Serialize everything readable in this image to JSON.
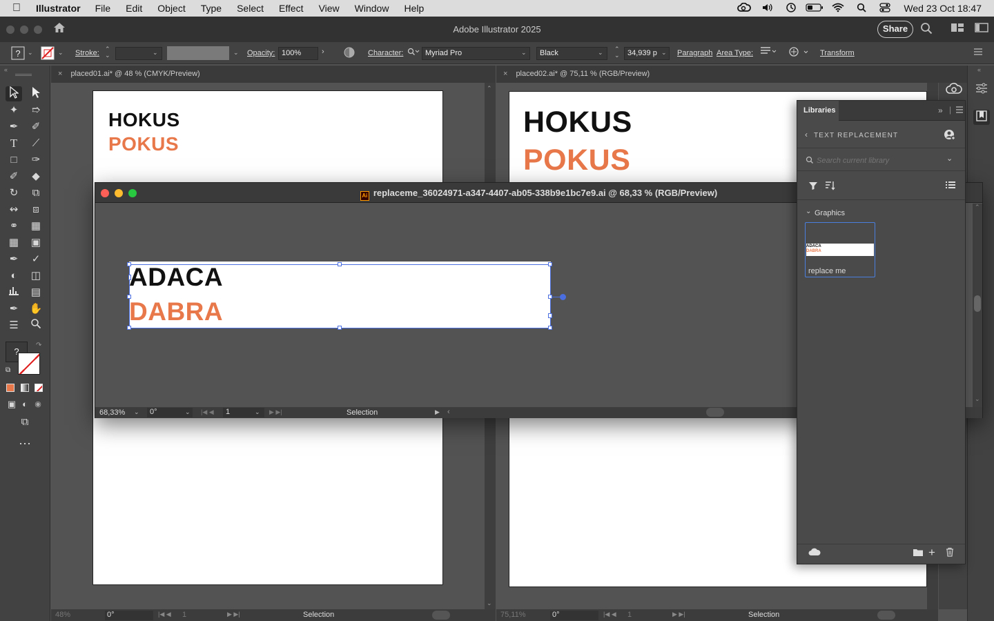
{
  "menubar": {
    "app_name": "Illustrator",
    "items": [
      "File",
      "Edit",
      "Object",
      "Type",
      "Select",
      "Effect",
      "View",
      "Window",
      "Help"
    ],
    "clock": "Wed 23 Oct  18:47"
  },
  "titlebar": {
    "title": "Adobe Illustrator 2025",
    "share_label": "Share"
  },
  "controlbar": {
    "stroke_label": "Stroke:",
    "opacity_label": "Opacity:",
    "opacity_value": "100%",
    "character_label": "Character:",
    "font_family": "Myriad Pro",
    "font_style": "Black",
    "font_size": "34,939 p",
    "paragraph_label": "Paragraph",
    "area_type_label": "Area Type:",
    "transform_label": "Transform"
  },
  "doc1": {
    "tab_title": "placed01.ai* @ 48 % (CMYK/Preview)",
    "line1": "HOKUS",
    "line2": "POKUS",
    "status": {
      "zoom": "48%",
      "rotate": "0°",
      "page": "1",
      "mode": "Selection"
    }
  },
  "doc2": {
    "tab_title": "placed02.ai* @ 75,11 % (RGB/Preview)",
    "line1": "HOKUS",
    "line2": "POKUS",
    "status": {
      "zoom": "75,11%",
      "rotate": "0°",
      "page": "1",
      "mode": "Selection"
    }
  },
  "floatdoc": {
    "title": "replaceme_36024971-a347-4407-ab05-338b9e1bc7e9.ai @ 68,33 % (RGB/Preview)",
    "line1": "ADACA",
    "line2": "DABRA",
    "status": {
      "zoom": "68,33%",
      "rotate": "0°",
      "page": "1",
      "mode": "Selection"
    }
  },
  "libraries": {
    "tab_label": "Libraries",
    "library_name": "TEXT REPLACEMENT",
    "search_placeholder": "Search current library",
    "section_label": "Graphics",
    "asset_label": "replace me",
    "thumb_line1": "ADACA",
    "thumb_line2": "DABRA"
  },
  "colors": {
    "accent_orange": "#e8784a",
    "selection_blue": "#4a6ee0",
    "ui_dark": "#424242",
    "canvas": "#535353"
  }
}
